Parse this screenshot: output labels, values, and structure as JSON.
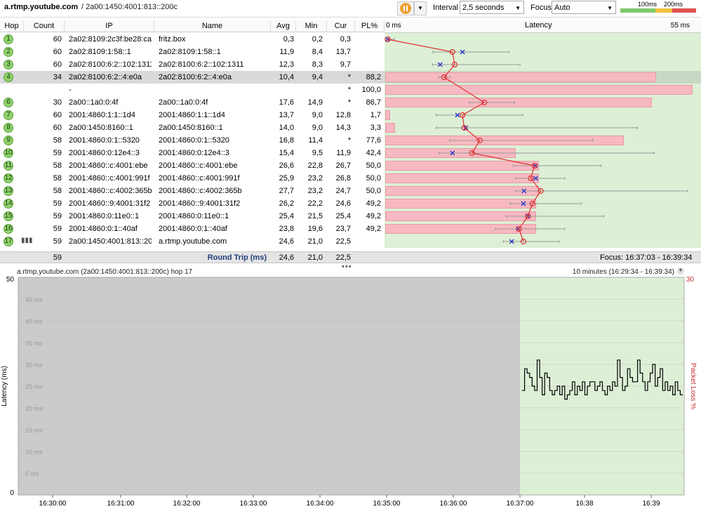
{
  "header": {
    "host": "a.rtmp.youtube.com",
    "ip_path": "/ 2a00:1450:4001:813::200c",
    "interval_label": "Interval",
    "interval_value": "2,5 seconds",
    "focus_label": "Focus",
    "focus_value": "Auto",
    "legend": [
      "100ms",
      "200ms"
    ]
  },
  "columns": [
    "Hop",
    "Count",
    "IP",
    "Name",
    "Avg",
    "Min",
    "Cur",
    "PL%"
  ],
  "latency_header": {
    "left": "0 ms",
    "title": "Latency",
    "right": "55 ms",
    "max_ms": 55
  },
  "hops": [
    {
      "hop": "1",
      "count": "60",
      "ip": "2a02:8109:2c3f:be28:ca0",
      "name": "fritz.box",
      "avg": "0,3",
      "min": "0,2",
      "cur": "0,3",
      "pl": "",
      "avg_ms": 0.3,
      "min_ms": 0.2,
      "max_ms": 1.5,
      "cur_ms": 0.3,
      "pl_pct": 0
    },
    {
      "hop": "2",
      "count": "60",
      "ip": "2a02:8109:1:58::1",
      "name": "2a02:8109:1:58::1",
      "avg": "11,9",
      "min": "8,4",
      "cur": "13,7",
      "pl": "",
      "avg_ms": 11.9,
      "min_ms": 8.4,
      "max_ms": 22.0,
      "cur_ms": 13.7,
      "pl_pct": 0
    },
    {
      "hop": "3",
      "count": "60",
      "ip": "2a02:8100:6:2::102:1311",
      "name": "2a02:8100:6:2::102:1311",
      "avg": "12,3",
      "min": "8,3",
      "cur": "9,7",
      "pl": "",
      "avg_ms": 12.3,
      "min_ms": 8.3,
      "max_ms": 24.0,
      "cur_ms": 9.7,
      "pl_pct": 0
    },
    {
      "hop": "4",
      "count": "34",
      "ip": "2a02:8100:6:2::4:e0a",
      "name": "2a02:8100:6:2::4:e0a",
      "avg": "10,4",
      "min": "9,4",
      "cur": "*",
      "pl": "88,2",
      "avg_ms": 10.4,
      "min_ms": 9.4,
      "max_ms": 11.5,
      "cur_ms": null,
      "pl_pct": 88.2,
      "selected": true
    },
    {
      "hop": "",
      "count": "",
      "ip": "-",
      "name": "",
      "avg": "",
      "min": "",
      "cur": "*",
      "pl": "100,0",
      "avg_ms": null,
      "min_ms": null,
      "max_ms": null,
      "cur_ms": null,
      "pl_pct": 100
    },
    {
      "hop": "6",
      "count": "30",
      "ip": "2a00::1a0:0:4f",
      "name": "2a00::1a0:0:4f",
      "avg": "17,6",
      "min": "14,9",
      "cur": "*",
      "pl": "86,7",
      "avg_ms": 17.6,
      "min_ms": 14.9,
      "max_ms": 23.0,
      "cur_ms": null,
      "pl_pct": 86.7
    },
    {
      "hop": "7",
      "count": "60",
      "ip": "2001:4860:1:1::1d4",
      "name": "2001:4860:1:1::1d4",
      "avg": "13,7",
      "min": "9,0",
      "cur": "12,8",
      "pl": "1,7",
      "avg_ms": 13.7,
      "min_ms": 9.0,
      "max_ms": 24.5,
      "cur_ms": 12.8,
      "pl_pct": 1.7
    },
    {
      "hop": "8",
      "count": "60",
      "ip": "2a00:1450:8160::1",
      "name": "2a00:1450:8160::1",
      "avg": "14,0",
      "min": "9,0",
      "cur": "14,3",
      "pl": "3,3",
      "avg_ms": 14.0,
      "min_ms": 9.0,
      "max_ms": 45.0,
      "cur_ms": 14.3,
      "pl_pct": 3.3
    },
    {
      "hop": "9",
      "count": "58",
      "ip": "2001:4860:0:1::5320",
      "name": "2001:4860:0:1::5320",
      "avg": "16,8",
      "min": "11,4",
      "cur": "*",
      "pl": "77,6",
      "avg_ms": 16.8,
      "min_ms": 11.4,
      "max_ms": 37.0,
      "cur_ms": null,
      "pl_pct": 77.6
    },
    {
      "hop": "10",
      "count": "59",
      "ip": "2001:4860:0:12e4::3",
      "name": "2001:4860:0:12e4::3",
      "avg": "15,4",
      "min": "9,5",
      "cur": "11,9",
      "pl": "42,4",
      "avg_ms": 15.4,
      "min_ms": 9.5,
      "max_ms": 48.0,
      "cur_ms": 11.9,
      "pl_pct": 42.4
    },
    {
      "hop": "11",
      "count": "58",
      "ip": "2001:4860::c:4001:ebe",
      "name": "2001:4860::c:4001:ebe",
      "avg": "26,6",
      "min": "22,8",
      "cur": "26,7",
      "pl": "50,0",
      "avg_ms": 26.6,
      "min_ms": 22.8,
      "max_ms": 38.5,
      "cur_ms": 26.7,
      "pl_pct": 50
    },
    {
      "hop": "12",
      "count": "58",
      "ip": "2001:4860::c:4001:991f",
      "name": "2001:4860::c:4001:991f",
      "avg": "25,9",
      "min": "23,2",
      "cur": "26,8",
      "pl": "50,0",
      "avg_ms": 25.9,
      "min_ms": 23.2,
      "max_ms": 32.0,
      "cur_ms": 26.8,
      "pl_pct": 50
    },
    {
      "hop": "13",
      "count": "58",
      "ip": "2001:4860::c:4002:365b",
      "name": "2001:4860::c:4002:365b",
      "avg": "27,7",
      "min": "23,2",
      "cur": "24,7",
      "pl": "50,0",
      "avg_ms": 27.7,
      "min_ms": 23.2,
      "max_ms": 54.0,
      "cur_ms": 24.7,
      "pl_pct": 50
    },
    {
      "hop": "14",
      "count": "59",
      "ip": "2001:4860::9:4001:31f2",
      "name": "2001:4860::9:4001:31f2",
      "avg": "26,2",
      "min": "22,2",
      "cur": "24,6",
      "pl": "49,2",
      "avg_ms": 26.2,
      "min_ms": 22.2,
      "max_ms": 35.0,
      "cur_ms": 24.6,
      "pl_pct": 49.2
    },
    {
      "hop": "15",
      "count": "59",
      "ip": "2001:4860:0:11e0::1",
      "name": "2001:4860:0:11e0::1",
      "avg": "25,4",
      "min": "21,5",
      "cur": "25,4",
      "pl": "49,2",
      "avg_ms": 25.4,
      "min_ms": 21.5,
      "max_ms": 39.0,
      "cur_ms": 25.4,
      "pl_pct": 49.2
    },
    {
      "hop": "16",
      "count": "59",
      "ip": "2001:4860:0:1::40af",
      "name": "2001:4860:0:1::40af",
      "avg": "23,8",
      "min": "19,6",
      "cur": "23,7",
      "pl": "49,2",
      "avg_ms": 23.8,
      "min_ms": 19.6,
      "max_ms": 32.0,
      "cur_ms": 23.7,
      "pl_pct": 49.2
    },
    {
      "hop": "17",
      "count": "59",
      "ip": "2a00:1450:4001:813::200",
      "name": "a.rtmp.youtube.com",
      "avg": "24,6",
      "min": "21,0",
      "cur": "22,5",
      "pl": "",
      "avg_ms": 24.6,
      "min_ms": 21.0,
      "max_ms": 31.0,
      "cur_ms": 22.5,
      "pl_pct": 0
    }
  ],
  "footer": {
    "count": "59",
    "label": "Round Trip (ms)",
    "avg": "24,6",
    "min": "21,0",
    "cur": "22,5",
    "focus": "Focus: 16:37:03 - 16:39:34"
  },
  "graph": {
    "title": "a.rtmp.youtube.com (2a00:1450:4001:813::200c) hop 17",
    "range": "10 minutes (16:29:34 - 16:39:34)",
    "y_axis_label": "Latency (ms)",
    "y2_axis_label": "Packet Loss %",
    "y_top_label": "50",
    "y_bottom_label": "0",
    "y2_top_label": "30",
    "y_grid_labels": [
      "45 ms",
      "40 ms",
      "35 ms",
      "30 ms",
      "25 ms",
      "20 ms",
      "15 ms",
      "10 ms",
      "5 ms"
    ],
    "x_labels": [
      "16:30:00",
      "16:31:00",
      "16:32:00",
      "16:33:00",
      "16:34:00",
      "16:35:00",
      "16:36:00",
      "16:37:00",
      "16:38",
      "16:39"
    ]
  },
  "chart_data": {
    "type": "line",
    "xlabel": "",
    "ylabel": "Latency (ms)",
    "ylim": [
      0,
      50
    ],
    "x_range": [
      "16:29:34",
      "16:39:34"
    ],
    "series": [
      {
        "values": [
          24,
          29,
          28,
          27,
          25,
          24,
          31,
          27,
          23,
          28,
          27,
          24,
          23,
          24,
          25,
          23,
          25,
          22,
          23,
          24,
          26,
          23,
          25,
          24,
          26,
          23,
          25,
          26,
          26,
          24,
          25,
          26,
          24,
          23,
          25,
          24,
          26,
          25,
          31,
          27,
          24,
          25,
          29,
          27,
          26,
          26,
          31,
          28,
          26,
          24,
          26,
          28,
          30,
          25,
          27,
          29,
          24,
          26,
          24,
          25,
          23,
          26,
          24,
          23
        ]
      }
    ]
  }
}
